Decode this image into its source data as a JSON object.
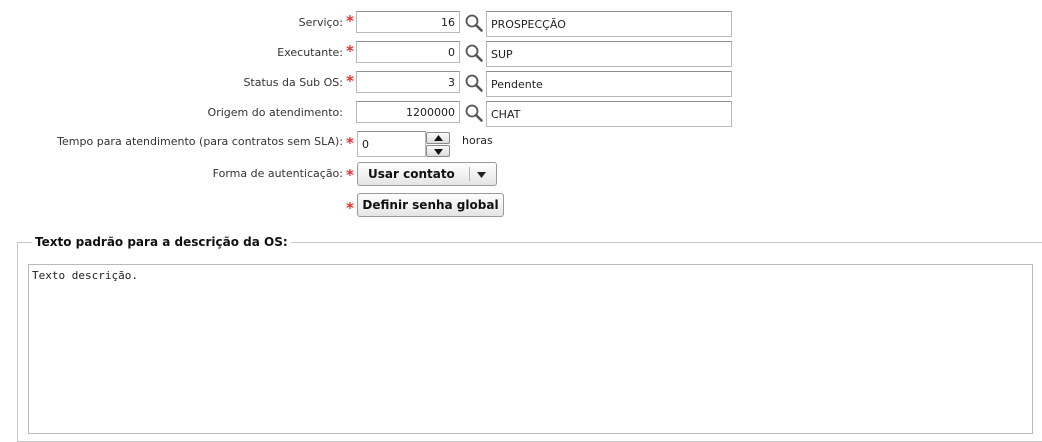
{
  "form": {
    "fields": [
      {
        "label": "Serviço:",
        "required": true,
        "code": "16",
        "description": "PROSPECÇÃO"
      },
      {
        "label": "Executante:",
        "required": true,
        "code": "0",
        "description": "SUP"
      },
      {
        "label": "Status da Sub OS:",
        "required": true,
        "code": "3",
        "description": "Pendente"
      },
      {
        "label": "Origem do atendimento:",
        "required": false,
        "code": "1200000",
        "description": "CHAT"
      }
    ],
    "required_mark": "*",
    "tempo": {
      "label": "Tempo para atendimento (para contratos sem SLA):",
      "value": "0",
      "unit": "horas"
    },
    "forma": {
      "label": "Forma de autenticação:",
      "selected": "Usar contato"
    },
    "senha_button": "Definir senha global"
  },
  "descricao": {
    "legend": "Texto padrão para a descrição da OS:",
    "value": "Texto descrição."
  },
  "icons": {
    "lookup": "magnifier-icon",
    "spin_up": "arrow-up-icon",
    "spin_down": "arrow-down-icon",
    "dropdown": "triangle-down-icon"
  },
  "colors": {
    "required": "#e0332f",
    "border": "#b9b9b9"
  }
}
